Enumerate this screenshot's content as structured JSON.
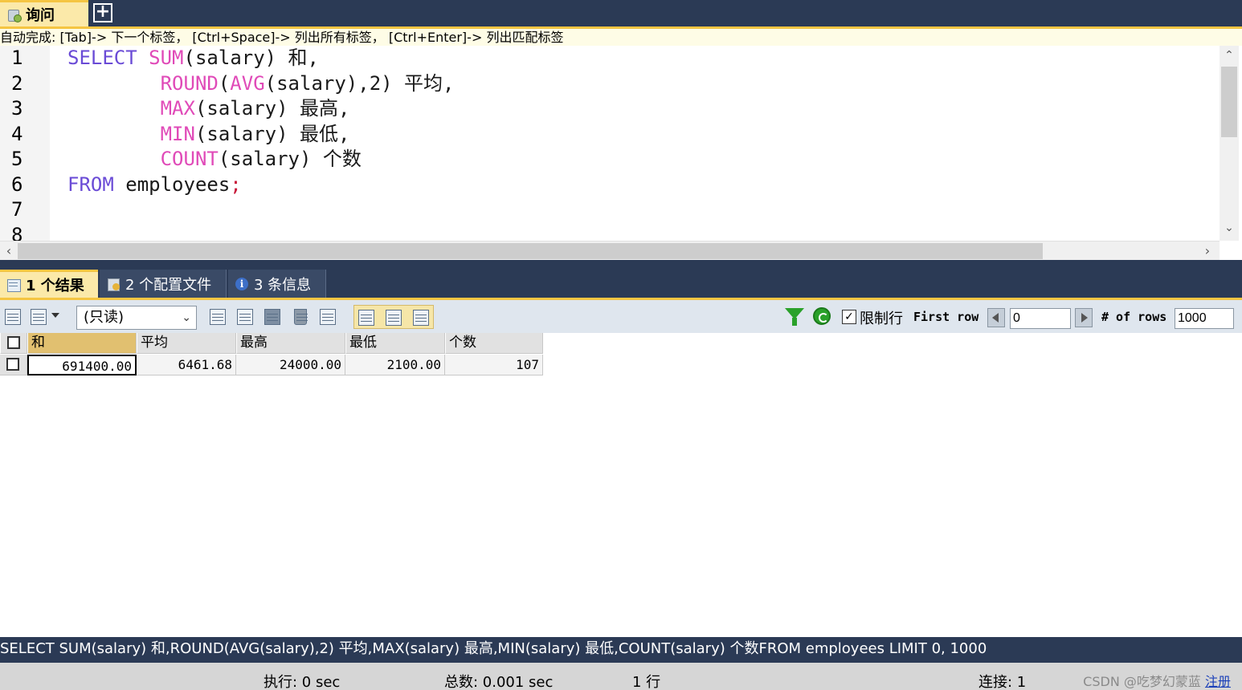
{
  "tabs": {
    "query_label": "询问",
    "add_label": "+"
  },
  "autocomplete_hint": "自动完成:  [Tab]-> 下一个标签，  [Ctrl+Space]-> 列出所有标签，  [Ctrl+Enter]-> 列出匹配标签",
  "editor": {
    "line_numbers": [
      "1",
      "2",
      "3",
      "4",
      "5",
      "6",
      "7",
      "8"
    ],
    "lines": [
      [
        {
          "t": "SELECT",
          "c": "kw"
        },
        {
          "t": " "
        },
        {
          "t": "SUM",
          "c": "fn"
        },
        {
          "t": "(salary) 和,"
        }
      ],
      [
        {
          "t": "        "
        },
        {
          "t": "ROUND",
          "c": "fn"
        },
        {
          "t": "("
        },
        {
          "t": "AVG",
          "c": "fn"
        },
        {
          "t": "(salary),2) 平均,"
        }
      ],
      [
        {
          "t": "        "
        },
        {
          "t": "MAX",
          "c": "fn"
        },
        {
          "t": "(salary) 最高,"
        }
      ],
      [
        {
          "t": "        "
        },
        {
          "t": "MIN",
          "c": "fn"
        },
        {
          "t": "(salary) 最低,"
        }
      ],
      [
        {
          "t": "        "
        },
        {
          "t": "COUNT",
          "c": "fn"
        },
        {
          "t": "(salary) 个数"
        }
      ],
      [
        {
          "t": "FROM",
          "c": "kw"
        },
        {
          "t": " employees"
        },
        {
          "t": ";",
          "c": "semi"
        }
      ],
      [
        {
          "t": ""
        }
      ],
      [
        {
          "t": ""
        }
      ]
    ]
  },
  "result_tabs": [
    {
      "label": "1 个结果",
      "icon": "grid-icon",
      "active": true
    },
    {
      "label": "2 个配置文件",
      "icon": "profile-icon",
      "active": false
    },
    {
      "label": "3 条信息",
      "icon": "info-icon",
      "active": false
    }
  ],
  "toolbar": {
    "mode_select": "(只读)",
    "limit_label": "限制行",
    "limit_checked": true,
    "first_row_label": "First row",
    "first_row_value": "0",
    "rows_label": "# of rows",
    "rows_value": "1000"
  },
  "grid": {
    "columns": [
      "和",
      "平均",
      "最高",
      "最低",
      "个数"
    ],
    "rows": [
      [
        "691400.00",
        "6461.68",
        "24000.00",
        "2100.00",
        "107"
      ]
    ]
  },
  "sql_status": "SELECT SUM(salary) 和,ROUND(AVG(salary),2) 平均,MAX(salary) 最高,MIN(salary) 最低,COUNT(salary) 个数FROM employees LIMIT 0, 1000",
  "status": {
    "exec": "执行: 0 sec",
    "total": "总数: 0.001 sec",
    "rows": "1 行",
    "conn": "连接: 1",
    "watermark": "CSDN @吃梦幻蒙蓝",
    "register": "注册"
  },
  "colors": {
    "keyword": "#6a4bd6",
    "function": "#e04ab8",
    "accent": "#f5c542",
    "chrome": "#2b3a55"
  }
}
